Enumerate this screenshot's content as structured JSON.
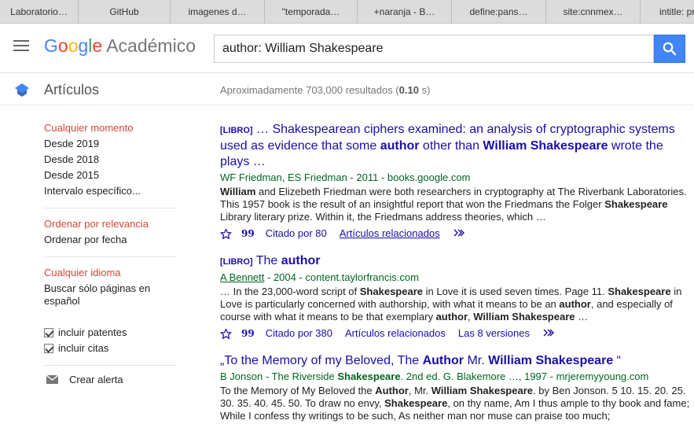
{
  "bookmarks": [
    {
      "label": "Laboratorio…"
    },
    {
      "label": "GitHub"
    },
    {
      "label": "imagenes d…"
    },
    {
      "label": "\"temporada…"
    },
    {
      "label": "+naranja - B…"
    },
    {
      "label": "define:pans…"
    },
    {
      "label": "site:cnnmex…"
    },
    {
      "label": "intitle: pr…"
    }
  ],
  "header": {
    "logo_google": "Google",
    "logo_product": "Académico",
    "search_value": "author: William Shakespeare"
  },
  "subheader": {
    "title": "Artículos",
    "results_prefix": "Aproximadamente 703,000 resultados (",
    "results_time": "0.10",
    "results_suffix": " s)"
  },
  "sidebar": {
    "time": {
      "active": "Cualquier momento",
      "items": [
        "Desde 2019",
        "Desde 2018",
        "Desde 2015",
        "Intervalo específico..."
      ]
    },
    "sort": {
      "active": "Ordenar por relevancia",
      "other": "Ordenar por fecha"
    },
    "language": {
      "active": "Cualquier idioma",
      "other": "Buscar sólo páginas en español"
    },
    "checks": {
      "patents": "incluir patentes",
      "citations": "incluir citas"
    },
    "alert": "Crear alerta"
  },
  "results": [
    {
      "tag": "[LIBRO]",
      "title_parts": [
        {
          "text": " … Shakespearean ciphers examined: an analysis of cryptographic systems used as evidence that some ",
          "bold": false
        },
        {
          "text": "author",
          "bold": true
        },
        {
          "text": " other than ",
          "bold": false
        },
        {
          "text": "William Shakespeare",
          "bold": true
        },
        {
          "text": " wrote the plays …",
          "bold": false
        }
      ],
      "meta_author": "",
      "meta": "WF Friedman, ES Friedman - 2011 - books.google.com",
      "snippet_parts": [
        {
          "text": "William",
          "bold": true
        },
        {
          "text": " and Elizebeth Friedman were both researchers in cryptography at The Riverbank Laboratories. This 1957 book is the result of an insightful report that won the Friedmans the Folger ",
          "bold": false
        },
        {
          "text": "Shakespeare",
          "bold": true
        },
        {
          "text": " Library literary prize. Within it, the Friedmans address theories, which …",
          "bold": false
        }
      ],
      "cited": "Citado por 80",
      "related": "Artículos relacionados",
      "versions": ""
    },
    {
      "tag": "[LIBRO]",
      "title_parts": [
        {
          "text": " The ",
          "bold": false
        },
        {
          "text": "author",
          "bold": true
        }
      ],
      "meta_author": "A Bennett",
      "meta": " - 2004 - content.taylorfrancis.com",
      "snippet_parts": [
        {
          "text": "… In the 23,000-word script of ",
          "bold": false
        },
        {
          "text": "Shakespeare",
          "bold": true
        },
        {
          "text": " in Love it is used seven times. Page 11. ",
          "bold": false
        },
        {
          "text": "Shakespeare",
          "bold": true
        },
        {
          "text": " in Love is particularly concerned with authorship, with what it means to be an ",
          "bold": false
        },
        {
          "text": "author",
          "bold": true
        },
        {
          "text": ", and especially of course with what it means to be that exemplary ",
          "bold": false
        },
        {
          "text": "author",
          "bold": true
        },
        {
          "text": ", ",
          "bold": false
        },
        {
          "text": "William Shakespeare",
          "bold": true
        },
        {
          "text": " …",
          "bold": false
        }
      ],
      "cited": "Citado por 380",
      "related": "Artículos relacionados",
      "versions": "Las 8 versiones"
    },
    {
      "tag": "",
      "title_parts": [
        {
          "text": "„To the Memory of my Beloved, The ",
          "bold": false
        },
        {
          "text": "Author",
          "bold": true
        },
        {
          "text": " Mr. ",
          "bold": false
        },
        {
          "text": "William Shakespeare",
          "bold": true
        },
        {
          "text": " “",
          "bold": false
        }
      ],
      "meta_author": "",
      "meta_rich": [
        {
          "text": "B Jonson - The Riverside ",
          "bold": false
        },
        {
          "text": "Shakespeare",
          "bold": true
        },
        {
          "text": ". 2nd ed. G. Blakemore …, 1997 - mrjeremyyoung.com",
          "bold": false
        }
      ],
      "snippet_parts": [
        {
          "text": "To the Memory of My Beloved the ",
          "bold": false
        },
        {
          "text": "Author",
          "bold": true
        },
        {
          "text": ", Mr. ",
          "bold": false
        },
        {
          "text": "William Shakespeare",
          "bold": true
        },
        {
          "text": ". by Ben Jonson. 5 10. 15. 20. 25. 30. 35. 40. 45. 50. To draw no envy, ",
          "bold": false
        },
        {
          "text": "Shakespeare",
          "bold": true
        },
        {
          "text": ", on thy name, Am I thus ample to thy book and fame; While I confess thy writings to be such, As neither man nor muse can praise too much;",
          "bold": false
        }
      ],
      "cited": "",
      "related": "",
      "versions": ""
    }
  ],
  "colors": {
    "accent_blue": "#4285f4",
    "link": "#1a0dab",
    "meta_green": "#006621",
    "active_red": "#d14836"
  },
  "icons": [
    "menu-icon",
    "search-icon",
    "scholar-cap-icon",
    "star-icon",
    "quote-icon",
    "chevrons-icon",
    "envelope-icon",
    "checkbox-icon"
  ]
}
